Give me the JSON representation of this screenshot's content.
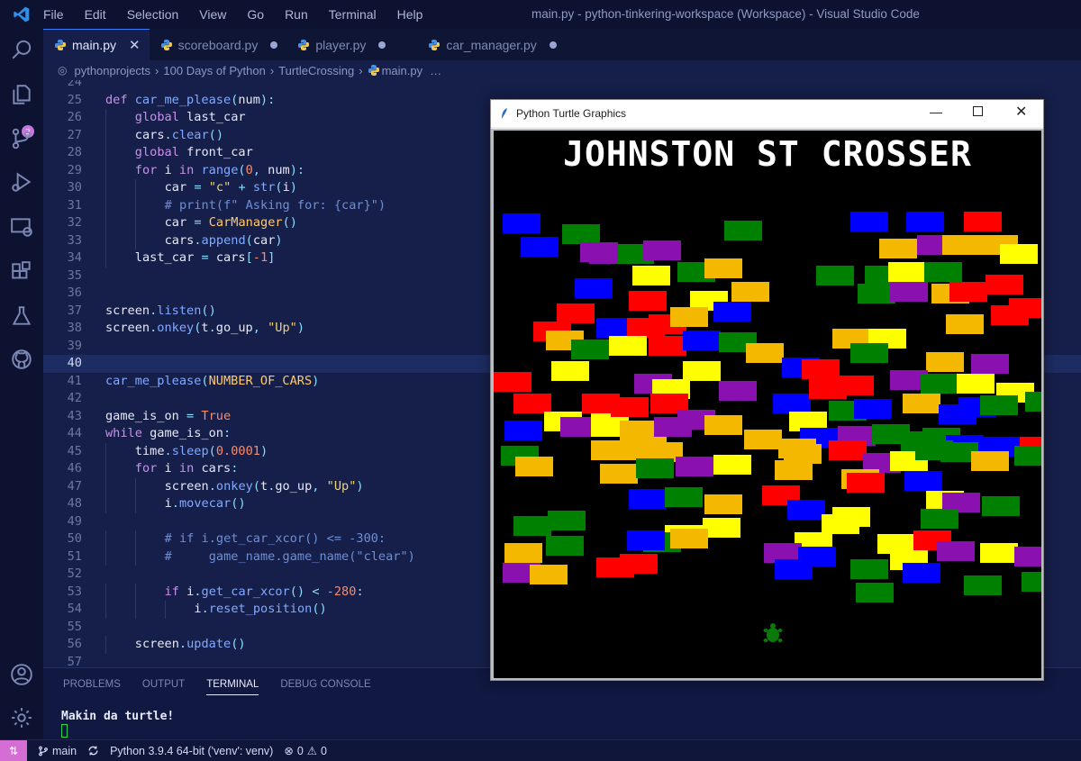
{
  "window": {
    "title": "main.py - python-tinkering-workspace (Workspace) - Visual Studio Code",
    "menu": [
      "File",
      "Edit",
      "Selection",
      "View",
      "Go",
      "Run",
      "Terminal",
      "Help"
    ]
  },
  "activity_bar": {
    "icons": [
      "search-icon",
      "explorer-icon",
      "source-control-icon",
      "run-debug-icon",
      "remote-explorer-icon",
      "extensions-icon",
      "testing-icon",
      "github-icon",
      "account-icon",
      "settings-gear-icon"
    ],
    "explorer_badge": "2"
  },
  "tabs": [
    {
      "label": "main.py",
      "active": true,
      "state": "close"
    },
    {
      "label": "scoreboard.py",
      "active": false,
      "state": "modified"
    },
    {
      "label": "player.py",
      "active": false,
      "state": "modified"
    },
    {
      "label": "car_manager.py",
      "active": false,
      "state": "modified"
    }
  ],
  "breadcrumbs": [
    "pythonprojects",
    "100 Days of Python",
    "TurtleCrossing",
    "main.py"
  ],
  "editor": {
    "current_line": 40,
    "lines": [
      {
        "n": 24,
        "indent": 0,
        "tokens": []
      },
      {
        "n": 25,
        "indent": 0,
        "tokens": [
          [
            "kw",
            "def "
          ],
          [
            "fn",
            "car_me_please"
          ],
          [
            "pun",
            "("
          ],
          [
            "id",
            "num"
          ],
          [
            "pun",
            "):"
          ]
        ]
      },
      {
        "n": 26,
        "indent": 1,
        "tokens": [
          [
            "kw",
            "global "
          ],
          [
            "id",
            "last_car"
          ]
        ]
      },
      {
        "n": 27,
        "indent": 1,
        "tokens": [
          [
            "id",
            "cars"
          ],
          [
            "pun",
            "."
          ],
          [
            "fn",
            "clear"
          ],
          [
            "pun",
            "()"
          ]
        ]
      },
      {
        "n": 28,
        "indent": 1,
        "tokens": [
          [
            "kw",
            "global "
          ],
          [
            "id",
            "front_car"
          ]
        ]
      },
      {
        "n": 29,
        "indent": 1,
        "tokens": [
          [
            "kw",
            "for "
          ],
          [
            "id",
            "i "
          ],
          [
            "kw",
            "in "
          ],
          [
            "fn",
            "range"
          ],
          [
            "pun",
            "("
          ],
          [
            "num",
            "0"
          ],
          [
            "pun",
            ", "
          ],
          [
            "id",
            "num"
          ],
          [
            "pun",
            "):"
          ]
        ]
      },
      {
        "n": 30,
        "indent": 2,
        "tokens": [
          [
            "id",
            "car "
          ],
          [
            "pun",
            "= "
          ],
          [
            "str",
            "\"c\" "
          ],
          [
            "pun",
            "+ "
          ],
          [
            "fn",
            "str"
          ],
          [
            "pun",
            "("
          ],
          [
            "id",
            "i"
          ],
          [
            "pun",
            ")"
          ]
        ]
      },
      {
        "n": 31,
        "indent": 2,
        "tokens": [
          [
            "cmt",
            "# print(f\" Asking for: {car}\")"
          ]
        ]
      },
      {
        "n": 32,
        "indent": 2,
        "tokens": [
          [
            "id",
            "car "
          ],
          [
            "pun",
            "= "
          ],
          [
            "cls",
            "CarManager"
          ],
          [
            "pun",
            "()"
          ]
        ]
      },
      {
        "n": 33,
        "indent": 2,
        "tokens": [
          [
            "id",
            "cars"
          ],
          [
            "pun",
            "."
          ],
          [
            "fn",
            "append"
          ],
          [
            "pun",
            "("
          ],
          [
            "id",
            "car"
          ],
          [
            "pun",
            ")"
          ]
        ]
      },
      {
        "n": 34,
        "indent": 1,
        "tokens": [
          [
            "id",
            "last_car "
          ],
          [
            "pun",
            "= "
          ],
          [
            "id",
            "cars"
          ],
          [
            "pun",
            "["
          ],
          [
            "num",
            "-1"
          ],
          [
            "pun",
            "]"
          ]
        ]
      },
      {
        "n": 35,
        "indent": 0,
        "tokens": []
      },
      {
        "n": 36,
        "indent": 0,
        "tokens": []
      },
      {
        "n": 37,
        "indent": 0,
        "tokens": [
          [
            "id",
            "screen"
          ],
          [
            "pun",
            "."
          ],
          [
            "fn",
            "listen"
          ],
          [
            "pun",
            "()"
          ]
        ]
      },
      {
        "n": 38,
        "indent": 0,
        "tokens": [
          [
            "id",
            "screen"
          ],
          [
            "pun",
            "."
          ],
          [
            "fn",
            "onkey"
          ],
          [
            "pun",
            "("
          ],
          [
            "id",
            "t"
          ],
          [
            "pun",
            "."
          ],
          [
            "id",
            "go_up"
          ],
          [
            "pun",
            ", "
          ],
          [
            "str",
            "\"Up\""
          ],
          [
            "pun",
            ")"
          ]
        ]
      },
      {
        "n": 39,
        "indent": 0,
        "tokens": []
      },
      {
        "n": 40,
        "indent": 0,
        "tokens": []
      },
      {
        "n": 41,
        "indent": 0,
        "tokens": [
          [
            "fn",
            "car_me_please"
          ],
          [
            "pun",
            "("
          ],
          [
            "cls",
            "NUMBER_OF_CARS"
          ],
          [
            "pun",
            ")"
          ]
        ]
      },
      {
        "n": 42,
        "indent": 0,
        "tokens": []
      },
      {
        "n": 43,
        "indent": 0,
        "tokens": [
          [
            "id",
            "game_is_on "
          ],
          [
            "pun",
            "= "
          ],
          [
            "num",
            "True"
          ]
        ]
      },
      {
        "n": 44,
        "indent": 0,
        "tokens": [
          [
            "kw",
            "while "
          ],
          [
            "id",
            "game_is_on"
          ],
          [
            "pun",
            ":"
          ]
        ]
      },
      {
        "n": 45,
        "indent": 1,
        "tokens": [
          [
            "id",
            "time"
          ],
          [
            "pun",
            "."
          ],
          [
            "fn",
            "sleep"
          ],
          [
            "pun",
            "("
          ],
          [
            "num",
            "0.0001"
          ],
          [
            "pun",
            ")"
          ]
        ]
      },
      {
        "n": 46,
        "indent": 1,
        "tokens": [
          [
            "kw",
            "for "
          ],
          [
            "id",
            "i "
          ],
          [
            "kw",
            "in "
          ],
          [
            "id",
            "cars"
          ],
          [
            "pun",
            ":"
          ]
        ]
      },
      {
        "n": 47,
        "indent": 2,
        "tokens": [
          [
            "id",
            "screen"
          ],
          [
            "pun",
            "."
          ],
          [
            "fn",
            "onkey"
          ],
          [
            "pun",
            "("
          ],
          [
            "id",
            "t"
          ],
          [
            "pun",
            "."
          ],
          [
            "id",
            "go_up"
          ],
          [
            "pun",
            ", "
          ],
          [
            "str",
            "\"Up\""
          ],
          [
            "pun",
            ")"
          ]
        ]
      },
      {
        "n": 48,
        "indent": 2,
        "tokens": [
          [
            "id",
            "i"
          ],
          [
            "pun",
            "."
          ],
          [
            "fn",
            "movecar"
          ],
          [
            "pun",
            "()"
          ]
        ]
      },
      {
        "n": 49,
        "indent": 0,
        "tokens": []
      },
      {
        "n": 50,
        "indent": 2,
        "tokens": [
          [
            "cmt",
            "# if i.get_car_xcor() <= -300:"
          ]
        ]
      },
      {
        "n": 51,
        "indent": 2,
        "tokens": [
          [
            "cmt",
            "#     game_name.game_name(\"clear\")"
          ]
        ]
      },
      {
        "n": 52,
        "indent": 0,
        "tokens": []
      },
      {
        "n": 53,
        "indent": 2,
        "tokens": [
          [
            "kw",
            "if "
          ],
          [
            "id",
            "i"
          ],
          [
            "pun",
            "."
          ],
          [
            "fn",
            "get_car_xcor"
          ],
          [
            "pun",
            "() "
          ],
          [
            "pun",
            "< "
          ],
          [
            "num",
            "-280"
          ],
          [
            "pun",
            ":"
          ]
        ]
      },
      {
        "n": 54,
        "indent": 3,
        "tokens": [
          [
            "id",
            "i"
          ],
          [
            "pun",
            "."
          ],
          [
            "fn",
            "reset_position"
          ],
          [
            "pun",
            "()"
          ]
        ]
      },
      {
        "n": 55,
        "indent": 0,
        "tokens": []
      },
      {
        "n": 56,
        "indent": 1,
        "tokens": [
          [
            "id",
            "screen"
          ],
          [
            "pun",
            "."
          ],
          [
            "fn",
            "update"
          ],
          [
            "pun",
            "()"
          ]
        ]
      },
      {
        "n": 57,
        "indent": 0,
        "tokens": []
      }
    ]
  },
  "panel": {
    "tabs": [
      "PROBLEMS",
      "OUTPUT",
      "TERMINAL",
      "DEBUG CONSOLE"
    ],
    "active_tab": "TERMINAL",
    "terminal_output": "Makin da turtle!"
  },
  "statusbar": {
    "branch": "main",
    "interpreter": "Python 3.9.4 64-bit ('venv': venv)",
    "errors": "0",
    "warnings": "0"
  },
  "turtle_window": {
    "title": "Python Turtle Graphics",
    "game_title": "JOHNSTON ST CROSSER",
    "colors": {
      "red": "#ff0000",
      "blue": "#0000ff",
      "green": "#008000",
      "yellow": "#ffff00",
      "orange": "#f5b800",
      "purple": "#8a10b0",
      "turtle": "#0a7a0a"
    }
  },
  "theme": {
    "accent": "#3b7bf5",
    "remote_button": "#d56ed4",
    "editor_bg": "#161f4a"
  }
}
